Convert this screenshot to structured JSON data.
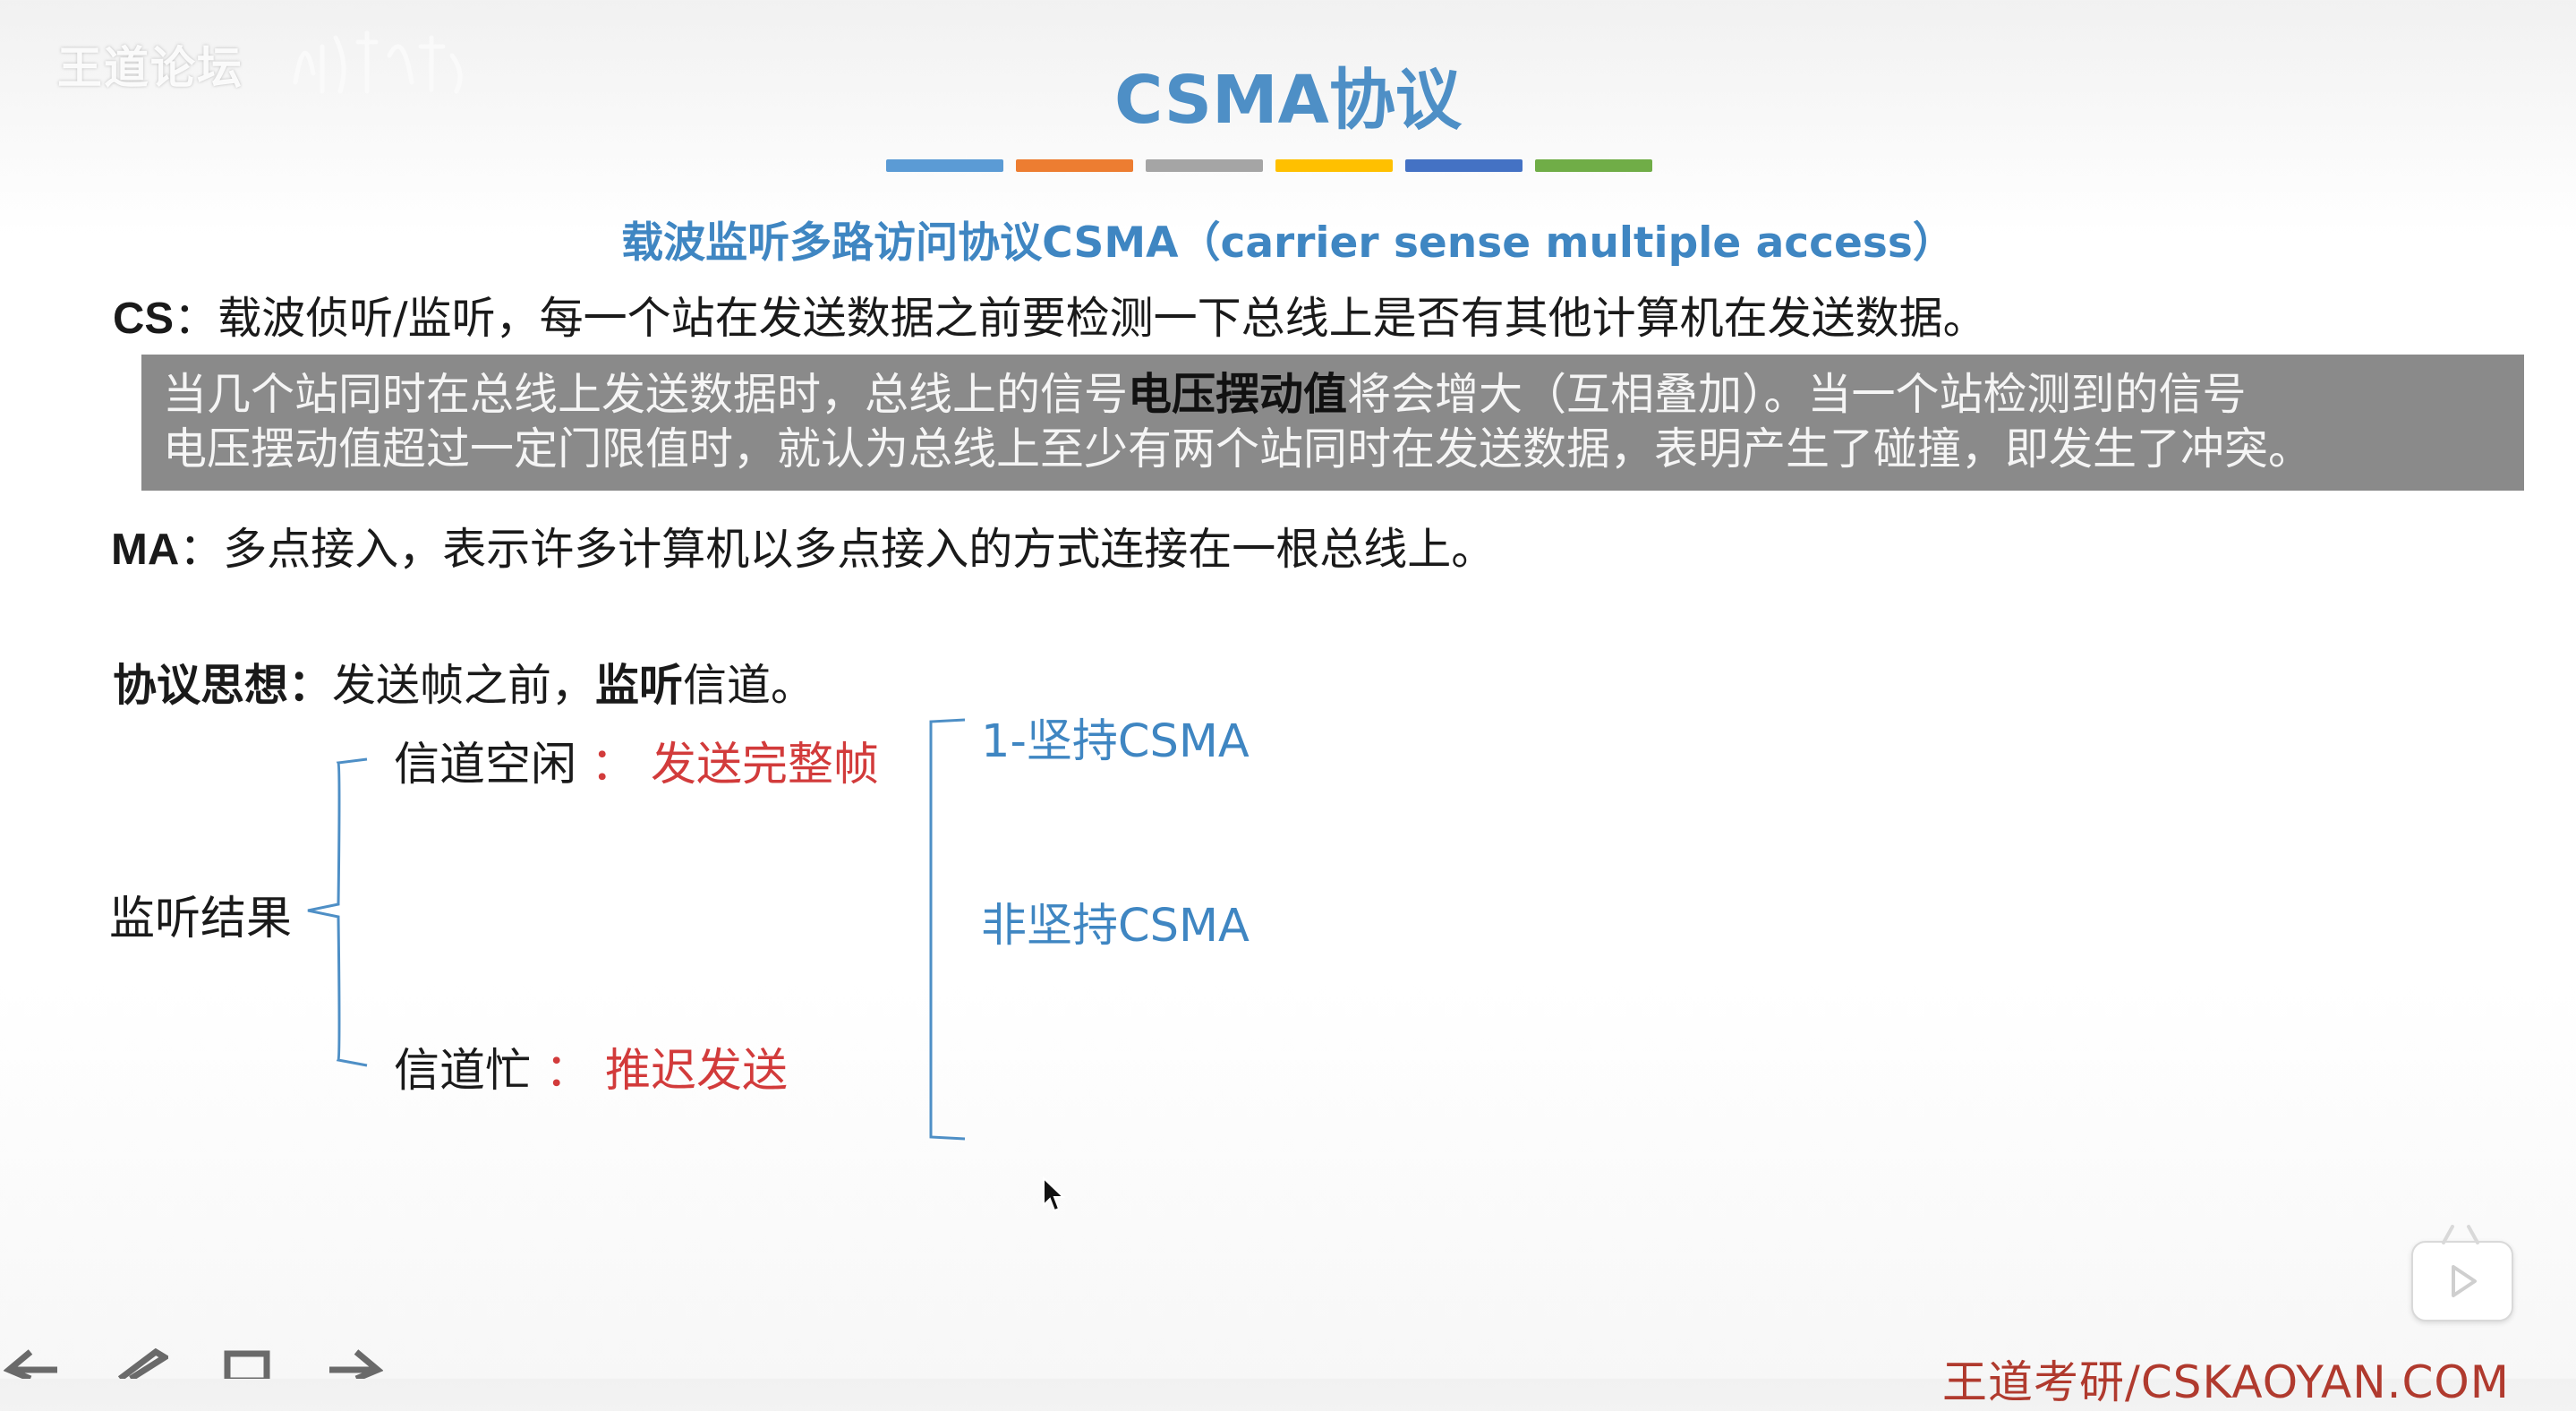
{
  "watermark": {
    "text": "王道论坛"
  },
  "slide": {
    "title": "CSMA协议",
    "color_bars": [
      "#5b9bd5",
      "#ed7d31",
      "#a5a5a5",
      "#ffc000",
      "#4472c4",
      "#70ad47"
    ],
    "subtitle": "载波监听多路访问协议CSMA（carrier sense multiple access）",
    "cs": {
      "label": "CS",
      "colon": "：",
      "text": "载波侦听/监听，每一个站在发送数据之前要检测一下总线上是否有其他计算机在发送数据。"
    },
    "note": {
      "part1": "当几个站同时在总线上发送数据时，总线上的信号",
      "highlight": "电压摆动值",
      "part2": "将会增大（互相叠加）。当一个站检测到的信号",
      "line2": "电压摆动值超过一定门限值时，就认为总线上至少有两个站同时在发送数据，表明产生了碰撞，即发生了冲突。"
    },
    "ma": {
      "label": "MA",
      "colon": "：",
      "text": "多点接入，表示许多计算机以多点接入的方式连接在一根总线上。"
    },
    "idea": {
      "label": "协议思想：",
      "text1": "发送帧之前，",
      "bold": "监听",
      "text2": "信道。"
    },
    "diagram": {
      "root": "监听结果",
      "idle_label": "信道空闲",
      "idle_colon": "：",
      "idle_action": "发送完整帧",
      "busy_label": "信道忙",
      "busy_colon": "：",
      "busy_action": "推迟发送",
      "types": [
        "1-坚持CSMA",
        "非坚持CSMA"
      ]
    }
  },
  "footer": {
    "text": "王道考研/CSKAOYAN.COM"
  }
}
